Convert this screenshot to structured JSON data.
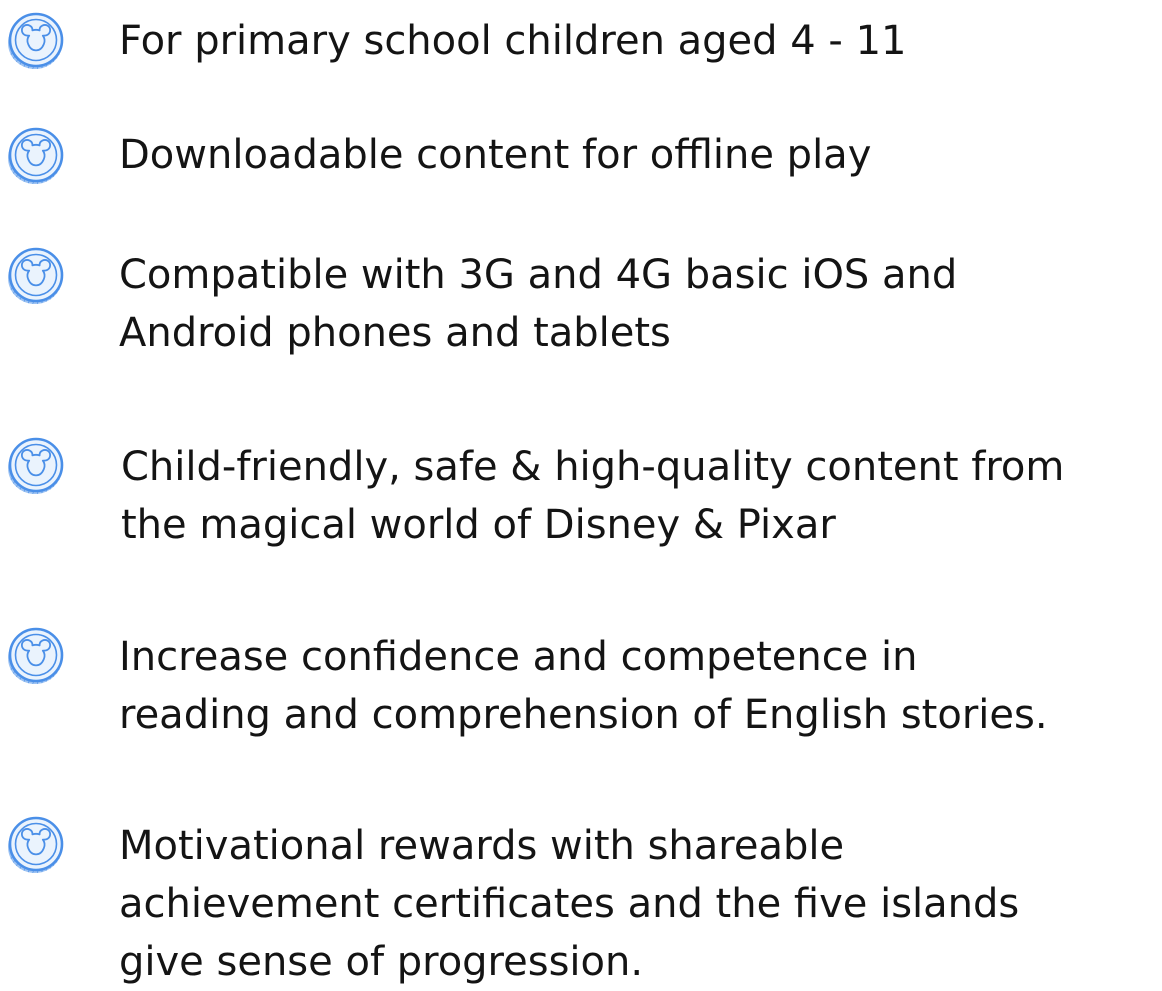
{
  "colors": {
    "icon_ring": "#4a8fe8",
    "icon_fill": "#eaf3fd",
    "text": "#141414"
  },
  "icon_name": "mickey-coin-icon",
  "features": [
    {
      "lines": [
        "For primary school children aged 4 - 11"
      ]
    },
    {
      "lines": [
        "Downloadable content for offline play"
      ]
    },
    {
      "lines": [
        "Compatible with 3G and 4G basic iOS and",
        "Android phones and tablets"
      ]
    },
    {
      "lines": [
        "Child-friendly, safe & high-quality content from",
        "the magical world of Disney & Pixar"
      ]
    },
    {
      "lines": [
        "Increase confidence and competence in",
        "reading and comprehension of English stories."
      ]
    },
    {
      "lines": [
        "Motivational rewards with shareable",
        "achievement certificates and the five islands",
        "give sense of progression."
      ]
    }
  ]
}
